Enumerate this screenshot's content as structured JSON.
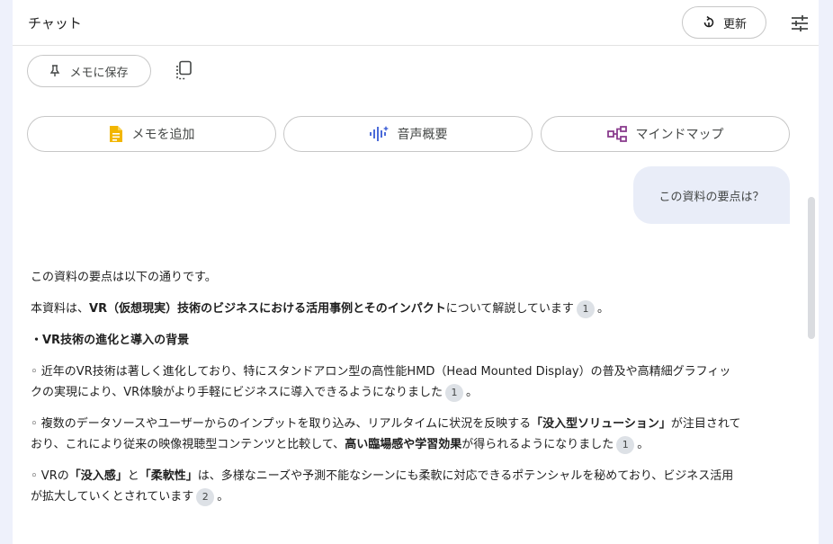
{
  "header": {
    "title": "チャット",
    "refresh_label": "更新"
  },
  "toolbar": {
    "save_memo_label": "メモに保存"
  },
  "actions": [
    {
      "label": "メモを追加",
      "icon": "note-icon",
      "color": "#f2b600"
    },
    {
      "label": "音声概要",
      "icon": "audio-waveform-icon",
      "color": "#4b6bd9"
    },
    {
      "label": "マインドマップ",
      "icon": "mindmap-icon",
      "color": "#8a3c8e"
    }
  ],
  "user_message": "この資料の要点は？",
  "answer": {
    "intro": "この資料の要点は以下の通りです。",
    "summary_pre": "本資料は、",
    "summary_bold": "VR（仮想現実）技術のビジネスにおける活用事例とそのインパクト",
    "summary_post": "について解説しています",
    "summary_cite": "1",
    "summary_end": "。",
    "section_title": "・VR技術の進化と導入の背景",
    "p1_pre": "◦ 近年のVR技術は著しく進化しており、特にスタンドアロン型の高性能HMD（Head Mounted Display）の普及や高精細グラフィックの実現により、VR体験がより手軽にビジネスに導入できるようになりました",
    "p1_cite": "1",
    "p1_end": "。",
    "p2_pre": "◦ 複数のデータソースやユーザーからのインプットを取り込み、リアルタイムに状況を反映する",
    "p2_bold1": "「没入型ソリューション」",
    "p2_mid": "が注目されており、これにより従来の映像視聴型コンテンツと比較して、",
    "p2_bold2": "高い臨場感や学習効果",
    "p2_post": "が得られるようになりました",
    "p2_cite": "1",
    "p2_end": "。",
    "p3_pre": "◦ VRの",
    "p3_bold1": "「没入感」",
    "p3_mid1": "と",
    "p3_bold2": "「柔軟性」",
    "p3_post": "は、多様なニーズや予測不能なシーンにも柔軟に対応できるポテンシャルを秘めており、ビジネス活用が拡大していくとされています",
    "p3_cite": "2",
    "p3_end": "。"
  }
}
